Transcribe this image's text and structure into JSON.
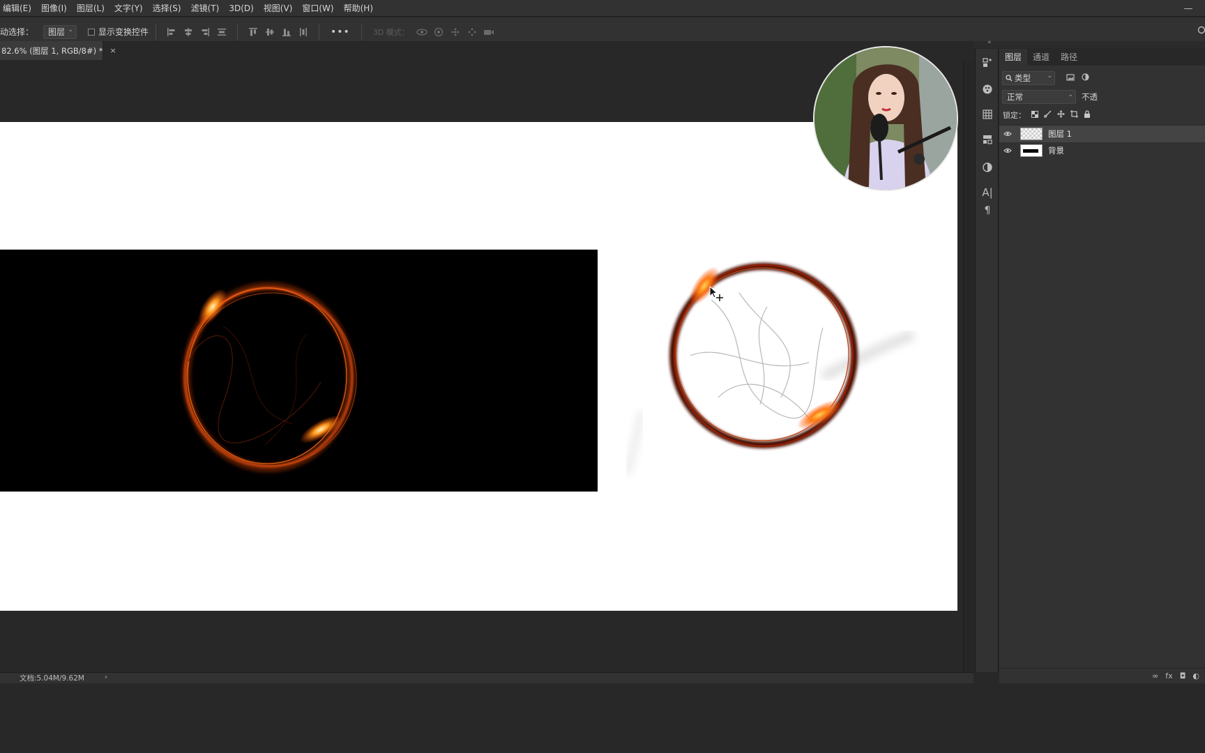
{
  "menu": {
    "items": [
      "编辑(E)",
      "图像(I)",
      "图层(L)",
      "文字(Y)",
      "选择(S)",
      "滤镜(T)",
      "3D(D)",
      "视图(V)",
      "窗口(W)",
      "帮助(H)"
    ]
  },
  "options": {
    "auto_select_label": "动选择：",
    "auto_select_value": "图层",
    "show_transform_label": "显示变换控件",
    "mode_3d_label": "3D 模式：",
    "more_label": "•••"
  },
  "document": {
    "tab_label": "82.6% (图层 1, RGB/8#) *",
    "close_glyph": "×"
  },
  "status": {
    "doc_size": "文档:5.04M/9.62M",
    "arrow": "›"
  },
  "layers_panel": {
    "tabs": [
      "图层",
      "通道",
      "路径"
    ],
    "active_tab": 0,
    "filter_kind": "类型",
    "blend_mode": "正常",
    "opacity_label": "不透",
    "lock_label": "锁定：",
    "layers": [
      {
        "name": "图层 1",
        "selected": true,
        "thumb": "transparent"
      },
      {
        "name": "背景",
        "selected": false,
        "thumb": "background"
      }
    ],
    "footer_icons": [
      "link-icon",
      "fx-icon",
      "mask-icon",
      "adjustment-icon"
    ],
    "footer_labels": [
      "∞",
      "fx",
      "◘",
      "◐"
    ]
  },
  "icons": {
    "right_strip": [
      "history-icon",
      "color-icon",
      "swatches-grid-icon",
      "libraries-icon",
      "adjustments-icon",
      "character-icon",
      "paragraph-icon"
    ]
  },
  "colors": {
    "app_bg": "#282828",
    "panel_bg": "#323232",
    "canvas_white": "#ffffff",
    "fire": "#ff7a12"
  }
}
